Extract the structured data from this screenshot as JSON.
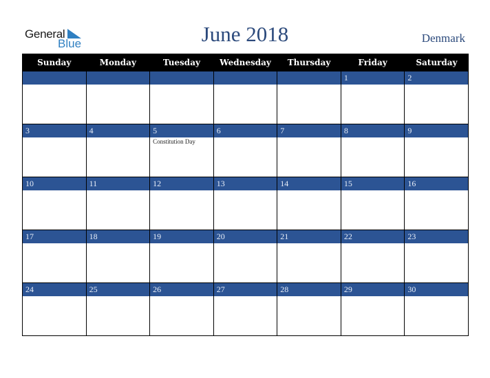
{
  "logo": {
    "line1": "General",
    "line2": "Blue"
  },
  "title": "June 2018",
  "country": "Denmark",
  "colors": {
    "band": "#2c5494",
    "header": "#000000",
    "title": "#2c4a7c",
    "logo_blue": "#2f7fc1"
  },
  "weekdays": [
    "Sunday",
    "Monday",
    "Tuesday",
    "Wednesday",
    "Thursday",
    "Friday",
    "Saturday"
  ],
  "weeks": [
    [
      {
        "day": ""
      },
      {
        "day": ""
      },
      {
        "day": ""
      },
      {
        "day": ""
      },
      {
        "day": ""
      },
      {
        "day": "1"
      },
      {
        "day": "2"
      }
    ],
    [
      {
        "day": "3"
      },
      {
        "day": "4"
      },
      {
        "day": "5",
        "event": "Constitution Day"
      },
      {
        "day": "6"
      },
      {
        "day": "7"
      },
      {
        "day": "8"
      },
      {
        "day": "9"
      }
    ],
    [
      {
        "day": "10"
      },
      {
        "day": "11"
      },
      {
        "day": "12"
      },
      {
        "day": "13"
      },
      {
        "day": "14"
      },
      {
        "day": "15"
      },
      {
        "day": "16"
      }
    ],
    [
      {
        "day": "17"
      },
      {
        "day": "18"
      },
      {
        "day": "19"
      },
      {
        "day": "20"
      },
      {
        "day": "21"
      },
      {
        "day": "22"
      },
      {
        "day": "23"
      }
    ],
    [
      {
        "day": "24"
      },
      {
        "day": "25"
      },
      {
        "day": "26"
      },
      {
        "day": "27"
      },
      {
        "day": "28"
      },
      {
        "day": "29"
      },
      {
        "day": "30"
      }
    ]
  ]
}
